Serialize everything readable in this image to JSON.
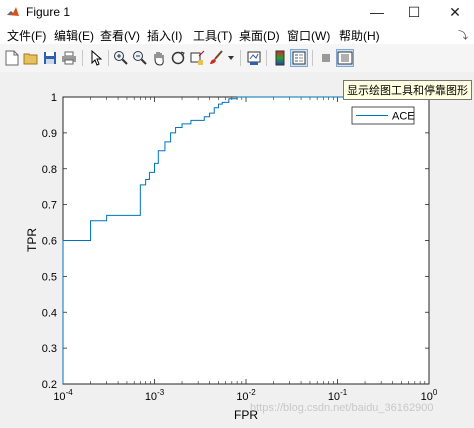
{
  "window": {
    "title": "Figure 1"
  },
  "menu": [
    "文件(F)",
    "编辑(E)",
    "查看(V)",
    "插入(I)",
    "工具(T)",
    "桌面(D)",
    "窗口(W)",
    "帮助(H)"
  ],
  "toolbar": {
    "icons": [
      "new-figure-icon",
      "open-file-icon",
      "save-icon",
      "print-icon",
      "pointer-icon",
      "zoom-in-icon",
      "zoom-out-icon",
      "pan-icon",
      "rotate-3d-icon",
      "data-cursor-icon",
      "brush-icon",
      "link-plot-icon",
      "colorbar-icon",
      "legend-icon",
      "hide-plot-tools-icon",
      "show-plot-tools-icon"
    ],
    "tooltip": "显示绘图工具和停靠图形"
  },
  "chart_data": {
    "type": "line",
    "xscale": "log",
    "xlim": [
      0.0001,
      1
    ],
    "ylim": [
      0.2,
      1
    ],
    "xlabel": "FPR",
    "ylabel": "TPR",
    "xticks": [
      "10^-4",
      "10^-3",
      "10^-2",
      "10^-1",
      "10^0"
    ],
    "yticks": [
      "0.2",
      "0.3",
      "0.4",
      "0.5",
      "0.6",
      "0.7",
      "0.8",
      "0.9",
      "1"
    ],
    "legend": {
      "position": "top-right",
      "entries": [
        "ACE"
      ]
    },
    "series": [
      {
        "name": "ACE",
        "color": "#0072bd",
        "x": [
          0.0001,
          0.0001,
          0.0002,
          0.0002,
          0.0003,
          0.0003,
          0.0007,
          0.0007,
          0.0008,
          0.0008,
          0.00088,
          0.00088,
          0.001,
          0.001,
          0.0011,
          0.0011,
          0.0013,
          0.0013,
          0.0015,
          0.0015,
          0.0017,
          0.0017,
          0.002,
          0.002,
          0.0025,
          0.0025,
          0.0035,
          0.0035,
          0.004,
          0.004,
          0.0045,
          0.0045,
          0.005,
          0.005,
          0.0055,
          0.0055,
          0.0065,
          0.0065,
          0.008,
          0.008,
          0.01,
          1
        ],
        "y": [
          0.2,
          0.6,
          0.6,
          0.655,
          0.655,
          0.67,
          0.67,
          0.755,
          0.755,
          0.77,
          0.77,
          0.79,
          0.79,
          0.815,
          0.815,
          0.85,
          0.85,
          0.875,
          0.875,
          0.9,
          0.9,
          0.915,
          0.915,
          0.925,
          0.925,
          0.935,
          0.935,
          0.945,
          0.945,
          0.955,
          0.955,
          0.97,
          0.97,
          0.98,
          0.98,
          0.985,
          0.985,
          0.995,
          0.995,
          1,
          1,
          1
        ]
      }
    ]
  },
  "watermark": "https://blog.csdn.net/baidu_36162900"
}
